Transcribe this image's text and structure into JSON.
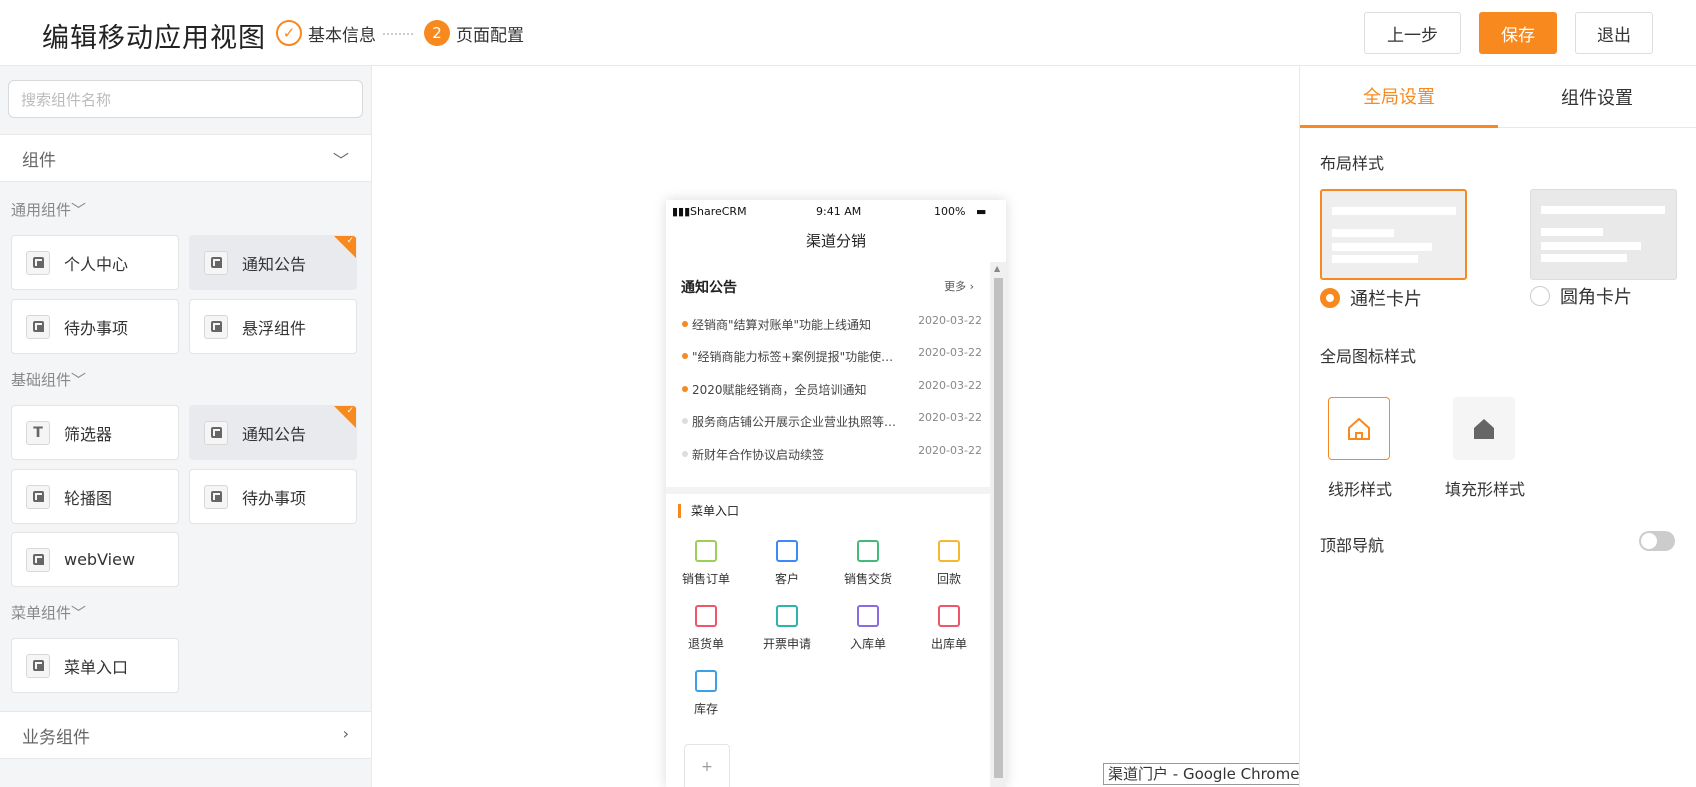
{
  "header": {
    "title": "编辑移动应用视图",
    "step1_label": "基本信息",
    "step2_num": "2",
    "step2_label": "页面配置",
    "prev_label": "上一步",
    "save_label": "保存",
    "exit_label": "退出"
  },
  "sidebar": {
    "search_placeholder": "搜索组件名称",
    "section_label": "组件",
    "groups": [
      {
        "title": "通用组件",
        "items": [
          "个人中心",
          "通知公告",
          "待办事项",
          "悬浮组件"
        ]
      },
      {
        "title": "基础组件",
        "items": [
          "筛选器",
          "通知公告",
          "轮播图",
          "待办事项",
          "webView"
        ]
      },
      {
        "title": "菜单组件",
        "items": [
          "菜单入口"
        ]
      }
    ],
    "business_label": "业务组件"
  },
  "phone": {
    "carrier": "ShareCRM",
    "time": "9:41 AM",
    "battery": "100%",
    "nav_title": "渠道分销",
    "notice": {
      "title": "通知公告",
      "more": "更多",
      "rows": [
        {
          "text": "经销商\"结算对账单\"功能上线通知",
          "date": "2020-03-22",
          "unread": true
        },
        {
          "text": "\"经销商能力标签+案例提报\"功能使用说明",
          "date": "2020-03-22",
          "unread": true
        },
        {
          "text": "2020赋能经销商，全员培训通知",
          "date": "2020-03-22",
          "unread": true
        },
        {
          "text": "服务商店铺公开展示企业营业执照等信息",
          "date": "2020-03-22",
          "unread": false
        },
        {
          "text": "新财年合作协议启动续签",
          "date": "2020-03-22",
          "unread": false
        }
      ]
    },
    "menu": {
      "title": "菜单入口",
      "items": [
        {
          "label": "销售订单",
          "color": "#9bcf5a"
        },
        {
          "label": "客户",
          "color": "#3d8af7"
        },
        {
          "label": "销售交货",
          "color": "#45b97c"
        },
        {
          "label": "回款",
          "color": "#f5b82e"
        },
        {
          "label": "退货单",
          "color": "#f0566a"
        },
        {
          "label": "开票申请",
          "color": "#2fb5a8"
        },
        {
          "label": "入库单",
          "color": "#8a6be0"
        },
        {
          "label": "出库单",
          "color": "#f0566a"
        },
        {
          "label": "库存",
          "color": "#3aa0e8"
        }
      ],
      "add": "+"
    }
  },
  "tooltip": "渠道门户 - Google Chrome",
  "settings": {
    "tab_global": "全局设置",
    "tab_component": "组件设置",
    "layout_label": "布局样式",
    "layout_opt1": "通栏卡片",
    "layout_opt2": "圆角卡片",
    "icon_label": "全局图标样式",
    "icon_opt1": "线形样式",
    "icon_opt2": "填充形样式",
    "topnav_label": "顶部导航"
  },
  "colors": {
    "accent": "#f7891f"
  }
}
